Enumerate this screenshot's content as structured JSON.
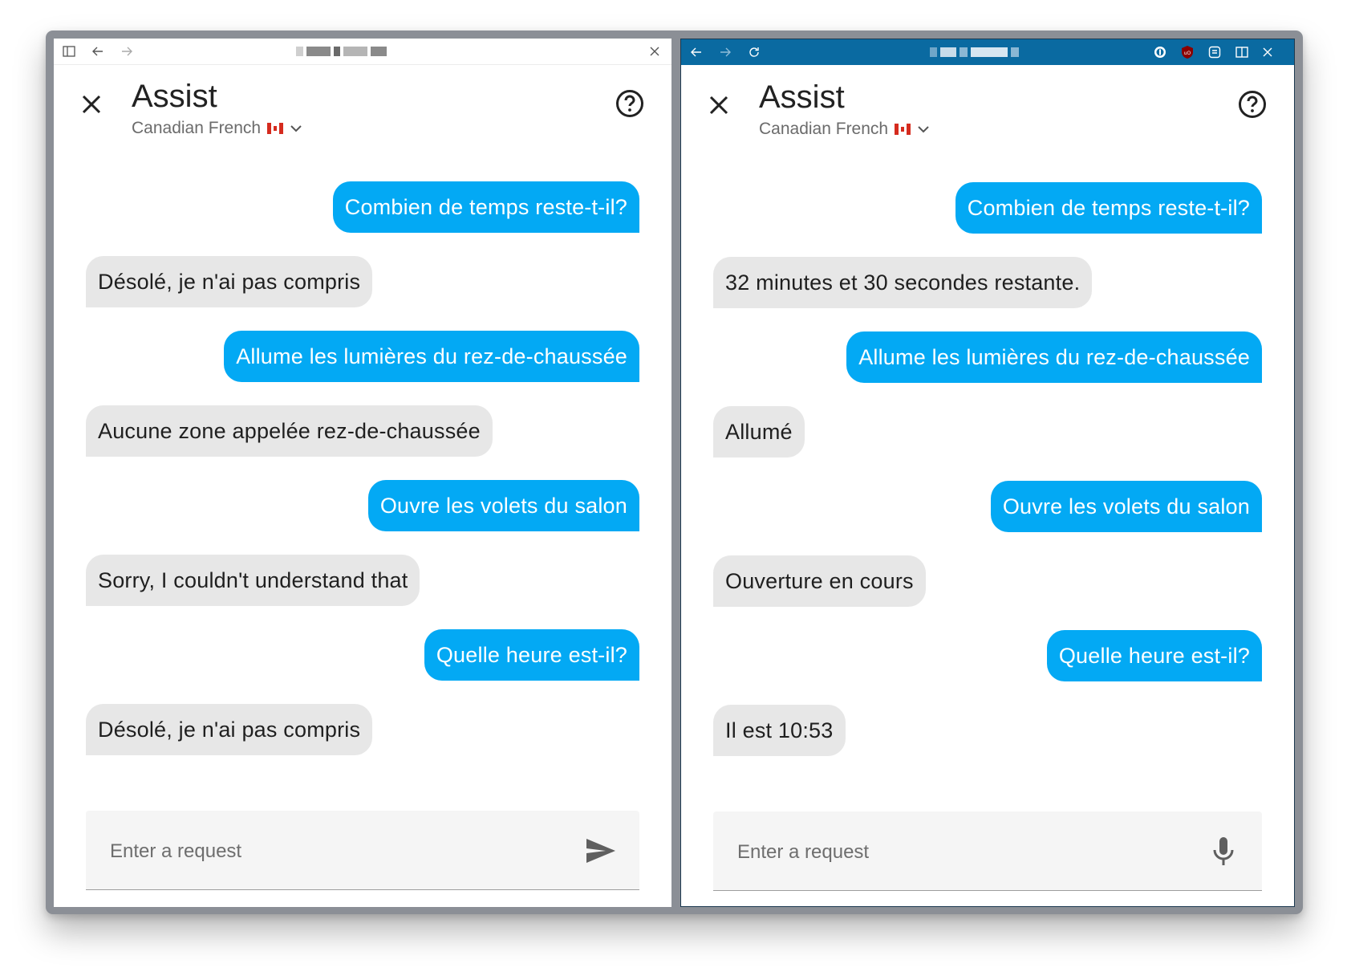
{
  "colors": {
    "user_bubble": "#03a9f4",
    "bot_bubble": "#e7e7e7",
    "dark_titlebar": "#0a6aa1"
  },
  "windows": [
    {
      "id": "left",
      "browser": {
        "icons": [
          "sidebar-toggle-icon",
          "back-arrow-icon",
          "forward-arrow-icon",
          "close-icon"
        ]
      },
      "dialog": {
        "title": "Assist",
        "language": "Canadian French",
        "help_icon": "help-circle-icon",
        "close_icon": "close-icon"
      },
      "messages": [
        {
          "role": "user",
          "text": "Combien de temps reste-t-il?"
        },
        {
          "role": "bot",
          "text": "Désolé, je n'ai pas compris"
        },
        {
          "role": "user",
          "text": "Allume les lumières du rez-de-chaussée"
        },
        {
          "role": "bot",
          "text": "Aucune zone appelée rez-de-chaussée"
        },
        {
          "role": "user",
          "text": "Ouvre les volets du salon"
        },
        {
          "role": "bot",
          "text": "Sorry, I couldn't understand that"
        },
        {
          "role": "user",
          "text": "Quelle heure est-il?"
        },
        {
          "role": "bot",
          "text": "Désolé, je n'ai pas compris"
        }
      ],
      "input": {
        "placeholder": "Enter a request",
        "button_icon": "send-icon"
      }
    },
    {
      "id": "right",
      "browser": {
        "icons": [
          "back-arrow-icon",
          "forward-arrow-icon",
          "reload-icon",
          "password-manager-icon",
          "ublock-icon",
          "extension-icon",
          "split-view-icon",
          "close-icon"
        ]
      },
      "dialog": {
        "title": "Assist",
        "language": "Canadian French",
        "help_icon": "help-circle-icon",
        "close_icon": "close-icon"
      },
      "messages": [
        {
          "role": "user",
          "text": "Combien de temps reste-t-il?"
        },
        {
          "role": "bot",
          "text": "32 minutes et 30 secondes restante."
        },
        {
          "role": "user",
          "text": "Allume les lumières du rez-de-chaussée"
        },
        {
          "role": "bot",
          "text": "Allumé"
        },
        {
          "role": "user",
          "text": "Ouvre les volets du salon"
        },
        {
          "role": "bot",
          "text": "Ouverture en cours"
        },
        {
          "role": "user",
          "text": "Quelle heure est-il?"
        },
        {
          "role": "bot",
          "text": "Il est 10:53"
        }
      ],
      "input": {
        "placeholder": "Enter a request",
        "button_icon": "microphone-icon"
      }
    }
  ]
}
